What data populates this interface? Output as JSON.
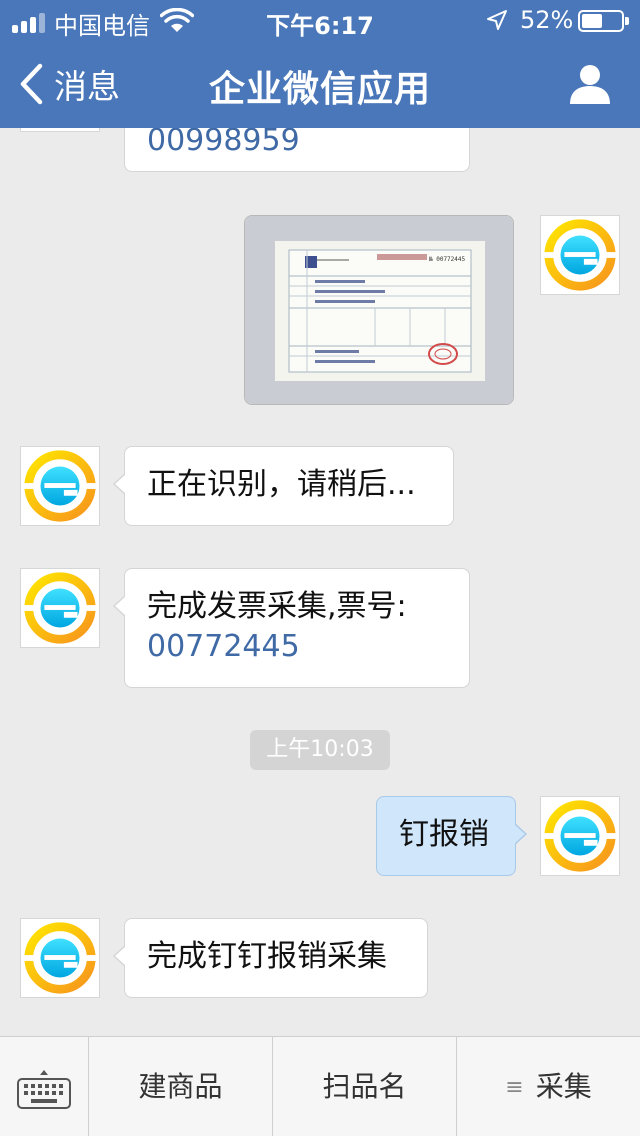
{
  "status_bar": {
    "carrier": "中国电信",
    "time": "下午6:17",
    "battery": "52%",
    "battery_level": 0.52
  },
  "nav": {
    "back_label": "消息",
    "title": "企业微信应用"
  },
  "messages": [
    {
      "sender": "app",
      "link_text": "00998959"
    },
    {
      "sender": "me",
      "type": "image",
      "invoice_no": "№ 00772445"
    },
    {
      "sender": "app",
      "text": "正在识别，请稍后..."
    },
    {
      "sender": "app",
      "text": "完成发票采集,票号:",
      "link_text": "00772445"
    },
    {
      "type": "timestamp",
      "text": "上午10:03"
    },
    {
      "sender": "me",
      "text": "钉报销"
    },
    {
      "sender": "app",
      "text": "完成钉钉报销采集"
    }
  ],
  "toolbar": {
    "items": [
      {
        "label": "建商品"
      },
      {
        "label": "扫品名"
      },
      {
        "label": "采集",
        "icon": "menu-icon"
      }
    ]
  },
  "colors": {
    "nav_bg": "#4a77b9",
    "link": "#3f6aa6",
    "outgoing_bubble": "#cfe6fb"
  }
}
